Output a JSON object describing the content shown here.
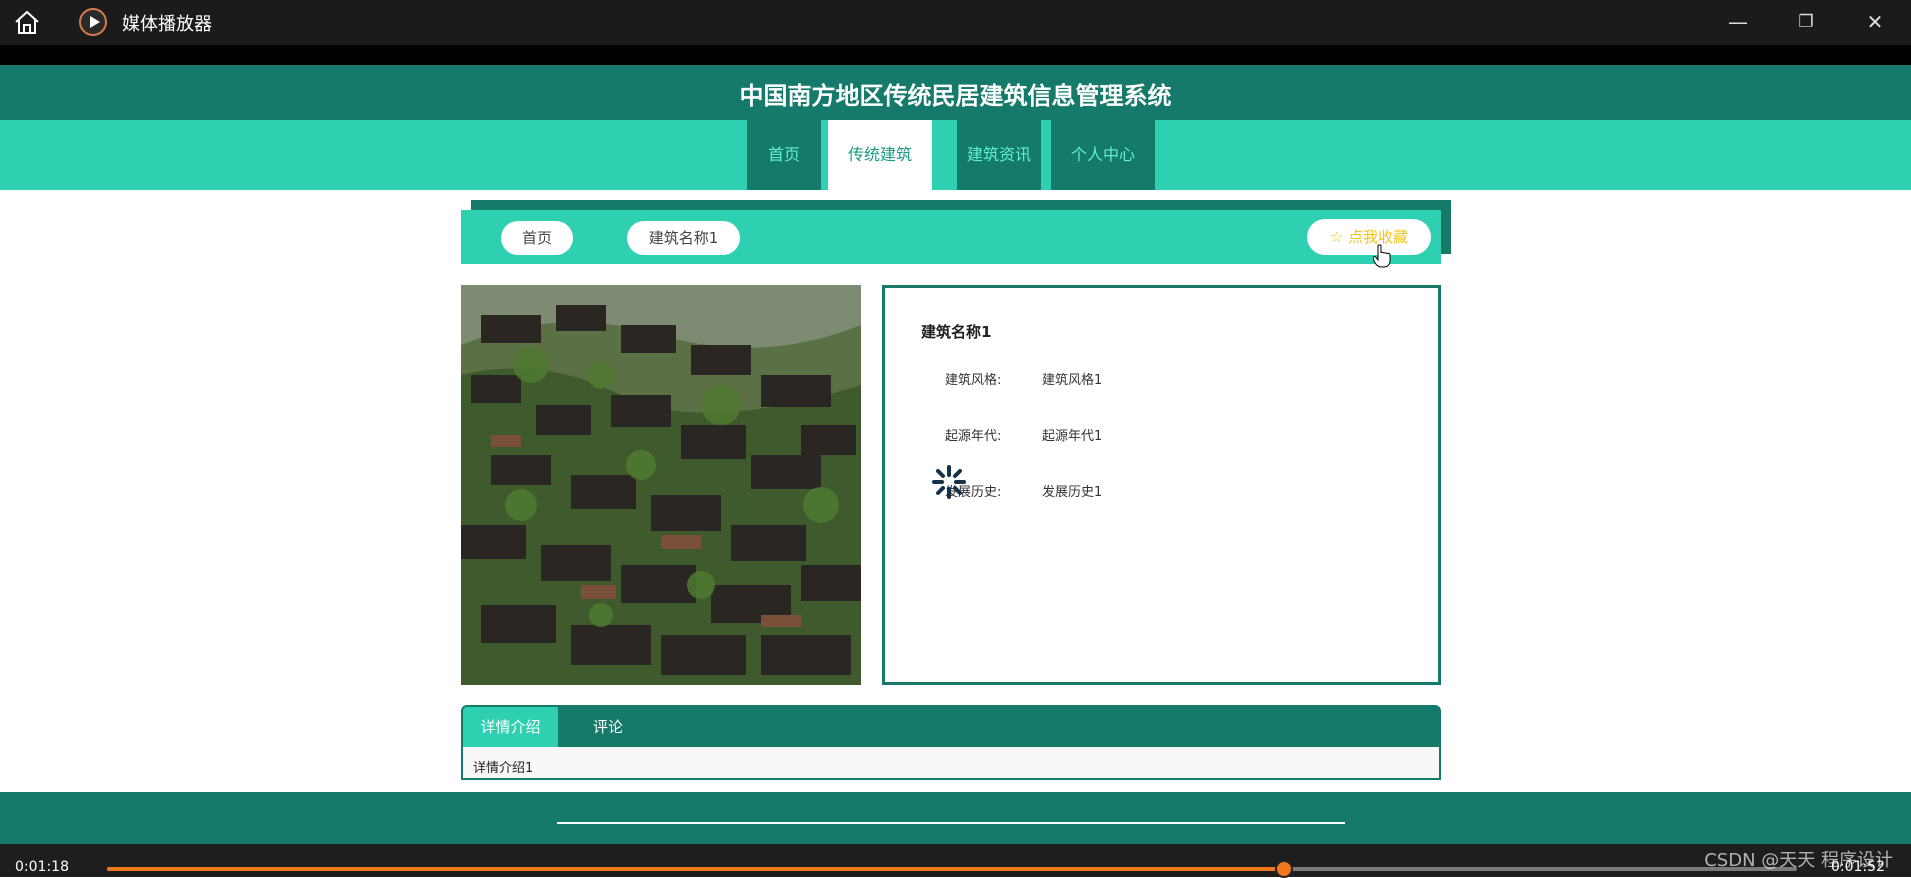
{
  "window": {
    "title": "媒体播放器",
    "buttons": {
      "minimize": "—",
      "maximize": "❐",
      "close": "✕"
    }
  },
  "site": {
    "title": "中国南方地区传统民居建筑信息管理系统",
    "nav": [
      {
        "label": "首页"
      },
      {
        "label": "传统建筑",
        "active": true
      },
      {
        "label": "建筑资讯"
      },
      {
        "label": "个人中心"
      }
    ]
  },
  "breadcrumb": {
    "home": "首页",
    "current": "建筑名称1",
    "favorite": "☆ 点我收藏"
  },
  "building": {
    "name": "建筑名称1",
    "fields": [
      {
        "label": "建筑风格:",
        "value": "建筑风格1"
      },
      {
        "label": "起源年代:",
        "value": "起源年代1"
      },
      {
        "label": "发展历史:",
        "value": "发展历史1"
      }
    ]
  },
  "tabs": {
    "items": [
      {
        "label": "详情介绍",
        "active": true
      },
      {
        "label": "评论"
      }
    ],
    "content": "详情介绍1"
  },
  "player": {
    "current_time": "0:01:18",
    "total_time": "0:01:52",
    "progress": 0.6964,
    "watermark": "CSDN @天天 程序设计"
  },
  "colors": {
    "header": "#157a69",
    "accent": "#2fcfb2",
    "progress": "#f0781e",
    "favorite": "#f2c41b"
  }
}
